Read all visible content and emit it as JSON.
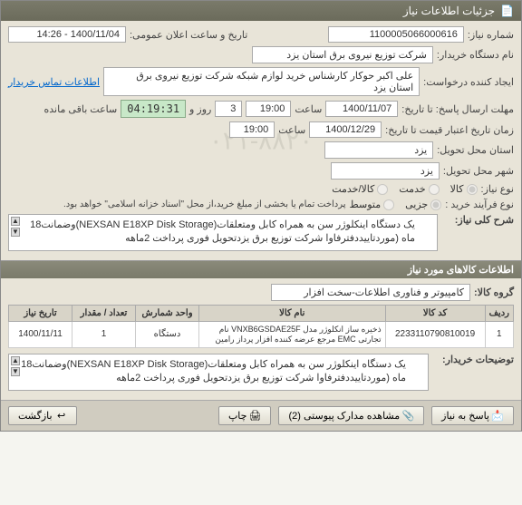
{
  "titlebar": "جزئیات اطلاعات نیاز",
  "form": {
    "need_number_label": "شماره نیاز:",
    "need_number": "1100005066000616",
    "announce_label": "تاریخ و ساعت اعلان عمومی:",
    "announce_value": "1400/11/04 - 14:26",
    "buyer_label": "نام دستگاه خریدار:",
    "buyer_value": "شرکت توزیع نیروی برق استان یزد",
    "creator_label": "ایجاد کننده درخواست:",
    "creator_value": "علی اکبر  حوکار  کارشناس خرید لوازم شبکه  شرکت توزیع نیروی برق استان یزد",
    "contact_link": "اطلاعات تماس خریدار",
    "deadline_label": "مهلت ارسال پاسخ: تا تاریخ:",
    "deadline_date": "1400/11/07",
    "deadline_time_label": "ساعت",
    "deadline_time": "19:00",
    "remaining_days": "3",
    "days_and": "روز و",
    "countdown": "04:19:31",
    "remaining_suffix": "ساعت باقی مانده",
    "validity_label": "زمان تاریخ اعتبار قیمت تا تاریخ:",
    "validity_date": "1400/12/29",
    "validity_time_label": "ساعت",
    "validity_time": "19:00",
    "province_label": "استان محل تحویل:",
    "province_value": "یزد",
    "city_label": "شهر محل تحویل:",
    "city_value": "یزد",
    "need_type_label": "نوع نیاز:",
    "radio_goods": "کالا",
    "radio_service": "خدمت",
    "radio_both": "کالا/خدمت",
    "purchase_type_label": "نوع فرآیند خرید :",
    "radio_small": "جزیی",
    "radio_medium": "متوسط",
    "purchase_note": "پرداخت تمام یا بخشی از مبلغ خرید،از محل \"اسناد خزانه اسلامی\" خواهد بود.",
    "desc_label": "شرح کلی نیاز:",
    "desc_text": "یک دستگاه اینکلوژر سن به همراه کابل ومتعلقات(NEXSAN E18XP Disk Storage)وضمانت18 ماه (موردتاییددفترفاوا شرکت توزیع برق یزدتحویل فوری پرداخت 2ماهه"
  },
  "section2": {
    "header": "اطلاعات کالاهای مورد نیاز",
    "group_label": "گروه کالا:",
    "group_value": "کامپیوتر و فناوری اطلاعات-سخت افزار"
  },
  "table": {
    "headers": {
      "row": "ردیف",
      "code": "کد کالا",
      "name": "نام کالا",
      "unit": "واحد شمارش",
      "qty": "تعداد / مقدار",
      "date": "تاریخ نیاز"
    },
    "rows": [
      {
        "row": "1",
        "code": "2233110790810019",
        "name": "ذخیره ساز انکلوژر مدل VNXB6GSDAE25F نام تجارتی EMC مرجع عرضه کننده افزار پرداز رامین",
        "unit": "دستگاه",
        "qty": "1",
        "date": "1400/11/11"
      }
    ]
  },
  "buyer_notes": {
    "label": "توضیحات خریدار:",
    "text": "یک دستگاه اینکلوژر سن به همراه کابل ومتعلقات(NEXSAN E18XP Disk Storage)وضمانت18 ماه (موردتاییددفترفاوا شرکت توزیع برق یزدتحویل فوری پرداخت 2ماهه"
  },
  "footer": {
    "reply": "پاسخ به نیاز",
    "attachments": "مشاهده مدارک پیوستی  (2)",
    "print": "چاپ",
    "back": "بازگشت"
  },
  "watermark": "۰۲۱-۸۸۲۰"
}
